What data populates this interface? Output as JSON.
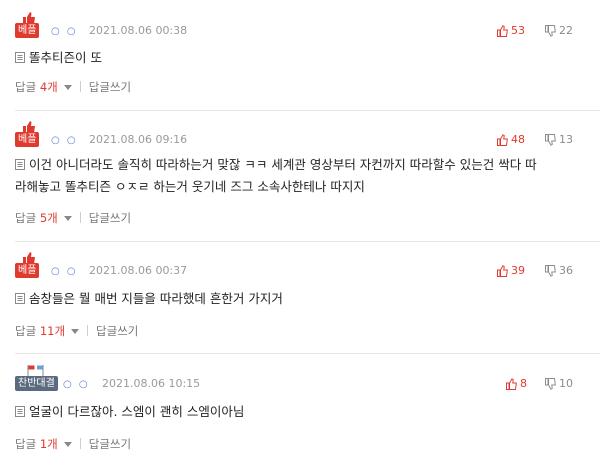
{
  "comments": [
    {
      "badge": "베플",
      "badge_type": "best",
      "dots": "○ ○",
      "time": "2021.08.06 00:38",
      "likes": "53",
      "dislikes": "22",
      "lines": [
        "똘추티즌이 또"
      ],
      "reply_label": "답글",
      "reply_count": "4개",
      "write_label": "답글쓰기"
    },
    {
      "badge": "베플",
      "badge_type": "best",
      "dots": "○ ○",
      "time": "2021.08.06 09:16",
      "likes": "48",
      "dislikes": "13",
      "lines": [
        "이건 아니더라도 솔직히 따라하는거 맞잖 ㅋㅋ 세계관 영상부터 자컨까지 따라할수 있는건 싹다 따",
        "라해놓고 똘추티즌 ㅇㅈㄹ 하는거 웃기네 즈그 소속사한테나 따지지"
      ],
      "reply_label": "답글",
      "reply_count": "5개",
      "write_label": "답글쓰기"
    },
    {
      "badge": "베플",
      "badge_type": "best",
      "dots": "○ ○",
      "time": "2021.08.06 00:37",
      "likes": "39",
      "dislikes": "36",
      "lines": [
        "솜창들은 뭘 매번 지들을 따라했데 흔한거 가지거"
      ],
      "reply_label": "답글",
      "reply_count": "11개",
      "write_label": "답글쓰기"
    },
    {
      "badge": "찬반대결",
      "badge_type": "vs",
      "dots": "○ ○",
      "time": "2021.08.06 10:15",
      "likes": "8",
      "dislikes": "10",
      "lines": [
        "얼굴이 다르잖아. 스엠이 괜히 스엠이아님"
      ],
      "reply_label": "답글",
      "reply_count": "1개",
      "write_label": "답글쓰기"
    }
  ],
  "colors": {
    "accent_red": "#e03a2e",
    "badge_gray": "#5b6b7f",
    "muted": "#9a9a9a"
  },
  "icons": {
    "best_badge_icon": "thumbs-up-icon",
    "vs_badge_icon": "flags-icon",
    "like_icon": "thumbs-up-icon",
    "dislike_icon": "thumbs-down-icon",
    "text_icon": "document-icon",
    "reply_toggle_icon": "caret-down-icon"
  }
}
